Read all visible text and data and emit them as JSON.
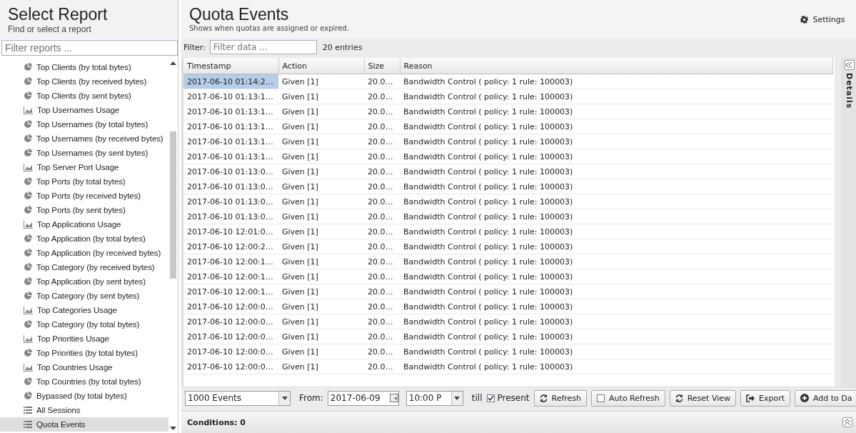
{
  "sidebar": {
    "title": "Select Report",
    "subtitle": "Find or select a report",
    "filter": {
      "placeholder": "Filter reports ..."
    },
    "items": [
      {
        "label": "Top Clients (by total bytes)",
        "kind": "pie",
        "selected": false
      },
      {
        "label": "Top Clients (by received bytes)",
        "kind": "pie",
        "selected": false
      },
      {
        "label": "Top Clients (by sent bytes)",
        "kind": "pie",
        "selected": false
      },
      {
        "label": "Top Usernames Usage",
        "kind": "area",
        "selected": false
      },
      {
        "label": "Top Usernames (by total bytes)",
        "kind": "pie",
        "selected": false
      },
      {
        "label": "Top Usernames (by received bytes)",
        "kind": "pie",
        "selected": false
      },
      {
        "label": "Top Usernames (by sent bytes)",
        "kind": "pie",
        "selected": false
      },
      {
        "label": "Top Server Port Usage",
        "kind": "area",
        "selected": false
      },
      {
        "label": "Top Ports (by total bytes)",
        "kind": "pie",
        "selected": false
      },
      {
        "label": "Top Ports (by received bytes)",
        "kind": "pie",
        "selected": false
      },
      {
        "label": "Top Ports (by sent bytes)",
        "kind": "pie",
        "selected": false
      },
      {
        "label": "Top Applications Usage",
        "kind": "area",
        "selected": false
      },
      {
        "label": "Top Application (by total bytes)",
        "kind": "pie",
        "selected": false
      },
      {
        "label": "Top Application (by received bytes)",
        "kind": "pie",
        "selected": false
      },
      {
        "label": "Top Category (by received bytes)",
        "kind": "pie",
        "selected": false
      },
      {
        "label": "Top Application (by sent bytes)",
        "kind": "pie",
        "selected": false
      },
      {
        "label": "Top Category (by sent bytes)",
        "kind": "pie",
        "selected": false
      },
      {
        "label": "Top Categories Usage",
        "kind": "area",
        "selected": false
      },
      {
        "label": "Top Category (by total bytes)",
        "kind": "pie",
        "selected": false
      },
      {
        "label": "Top Priorities Usage",
        "kind": "area",
        "selected": false
      },
      {
        "label": "Top Priorities (by total bytes)",
        "kind": "pie",
        "selected": false
      },
      {
        "label": "Top Countries Usage",
        "kind": "area",
        "selected": false
      },
      {
        "label": "Top Countries (by total bytes)",
        "kind": "pie",
        "selected": false
      },
      {
        "label": "Bypassed (by total bytes)",
        "kind": "pie",
        "selected": false
      },
      {
        "label": "All Sessions",
        "kind": "list",
        "selected": false
      },
      {
        "label": "Quota Events",
        "kind": "list",
        "selected": true
      }
    ]
  },
  "main": {
    "title": "Quota Events",
    "subtitle": "Shows when quotas are assigned or expired.",
    "settings": "Settings",
    "filter": {
      "label": "Filter:",
      "placeholder": "Filter data ..."
    },
    "entries": "20 entries",
    "table": {
      "columns": [
        "Timestamp",
        "Action",
        "Size",
        "Reason"
      ],
      "rows": [
        {
          "cells": [
            "2017-06-10 01:14:2…",
            "Given [1]",
            "20.0…",
            "Bandwidth Control ( policy: 1 rule: 100003)"
          ],
          "selected": true
        },
        {
          "cells": [
            "2017-06-10 01:13:1…",
            "Given [1]",
            "20.0…",
            "Bandwidth Control ( policy: 1 rule: 100003)"
          ],
          "selected": false
        },
        {
          "cells": [
            "2017-06-10 01:13:1…",
            "Given [1]",
            "20.0…",
            "Bandwidth Control ( policy: 1 rule: 100003)"
          ],
          "selected": false
        },
        {
          "cells": [
            "2017-06-10 01:13:1…",
            "Given [1]",
            "20.0…",
            "Bandwidth Control ( policy: 1 rule: 100003)"
          ],
          "selected": false
        },
        {
          "cells": [
            "2017-06-10 01:13:1…",
            "Given [1]",
            "20.0…",
            "Bandwidth Control ( policy: 1 rule: 100003)"
          ],
          "selected": false
        },
        {
          "cells": [
            "2017-06-10 01:13:1…",
            "Given [1]",
            "20.0…",
            "Bandwidth Control ( policy: 1 rule: 100003)"
          ],
          "selected": false
        },
        {
          "cells": [
            "2017-06-10 01:13:0…",
            "Given [1]",
            "20.0…",
            "Bandwidth Control ( policy: 1 rule: 100003)"
          ],
          "selected": false
        },
        {
          "cells": [
            "2017-06-10 01:13:0…",
            "Given [1]",
            "20.0…",
            "Bandwidth Control ( policy: 1 rule: 100003)"
          ],
          "selected": false
        },
        {
          "cells": [
            "2017-06-10 01:13:0…",
            "Given [1]",
            "20.0…",
            "Bandwidth Control ( policy: 1 rule: 100003)"
          ],
          "selected": false
        },
        {
          "cells": [
            "2017-06-10 01:13:0…",
            "Given [1]",
            "20.0…",
            "Bandwidth Control ( policy: 1 rule: 100003)"
          ],
          "selected": false
        },
        {
          "cells": [
            "2017-06-10 12:01:0…",
            "Given [1]",
            "20.0…",
            "Bandwidth Control ( policy: 1 rule: 100003)"
          ],
          "selected": false
        },
        {
          "cells": [
            "2017-06-10 12:00:2…",
            "Given [1]",
            "20.0…",
            "Bandwidth Control ( policy: 1 rule: 100003)"
          ],
          "selected": false
        },
        {
          "cells": [
            "2017-06-10 12:00:1…",
            "Given [1]",
            "20.0…",
            "Bandwidth Control ( policy: 1 rule: 100003)"
          ],
          "selected": false
        },
        {
          "cells": [
            "2017-06-10 12:00:1…",
            "Given [1]",
            "20.0…",
            "Bandwidth Control ( policy: 1 rule: 100003)"
          ],
          "selected": false
        },
        {
          "cells": [
            "2017-06-10 12:00:1…",
            "Given [1]",
            "20.0…",
            "Bandwidth Control ( policy: 1 rule: 100003)"
          ],
          "selected": false
        },
        {
          "cells": [
            "2017-06-10 12:00:0…",
            "Given [1]",
            "20.0…",
            "Bandwidth Control ( policy: 1 rule: 100003)"
          ],
          "selected": false
        },
        {
          "cells": [
            "2017-06-10 12:00:0…",
            "Given [1]",
            "20.0…",
            "Bandwidth Control ( policy: 1 rule: 100003)"
          ],
          "selected": false
        },
        {
          "cells": [
            "2017-06-10 12:00:0…",
            "Given [1]",
            "20.0…",
            "Bandwidth Control ( policy: 1 rule: 100003)"
          ],
          "selected": false
        },
        {
          "cells": [
            "2017-06-10 12:00:0…",
            "Given [1]",
            "20.0…",
            "Bandwidth Control ( policy: 1 rule: 100003)"
          ],
          "selected": false
        },
        {
          "cells": [
            "2017-06-10 12:00:0…",
            "Given [1]",
            "20.0…",
            "Bandwidth Control ( policy: 1 rule: 100003)"
          ],
          "selected": false
        }
      ]
    },
    "details_label": "Details",
    "toolbar": {
      "limit": "1000 Events",
      "from_label": "From:",
      "date": "2017-06-09",
      "time": "10:00 P",
      "till_label": "till",
      "present": {
        "label": "Present",
        "checked": true
      },
      "buttons": [
        {
          "label": "Refresh",
          "kind": "refresh"
        },
        {
          "label": "Auto Refresh",
          "kind": "checkbox",
          "checked": false
        },
        {
          "label": "Reset View",
          "kind": "refresh"
        },
        {
          "label": "Export",
          "kind": "export"
        },
        {
          "label": "Add to Da",
          "kind": "add"
        }
      ]
    },
    "conditions": "Conditions: 0"
  }
}
